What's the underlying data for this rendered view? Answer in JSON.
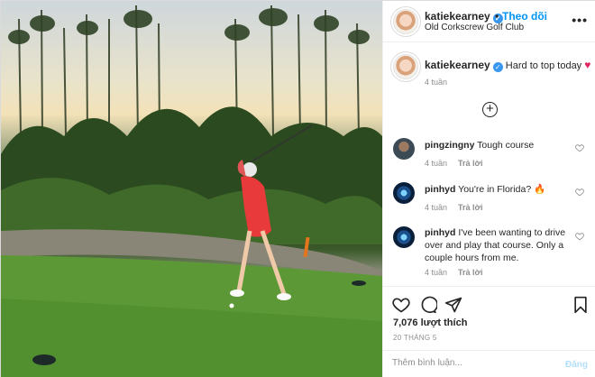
{
  "photo": {
    "description_icon": "golf-swing-photo"
  },
  "header": {
    "username": "katiekearney",
    "follow_label": "Theo dõi",
    "separator": "•",
    "location": "Old Corkscrew Golf Club",
    "more_icon": "more-options-icon",
    "more_text": "•••"
  },
  "caption": {
    "username": "katiekearney",
    "text": "Hard to top today",
    "emoji": "♥",
    "time": "4 tuần"
  },
  "load_more": {
    "icon": "plus-circle-icon",
    "text": "+"
  },
  "comments": [
    {
      "username": "pingzingny",
      "text": "Tough course",
      "time": "4 tuần",
      "reply": "Trả lời"
    },
    {
      "username": "pinhyd",
      "text": "You're in Florida? 🔥",
      "time": "4 tuần",
      "reply": "Trả lời"
    },
    {
      "username": "pinhyd",
      "text": "I've been wanting to drive over and play that course. Only a couple hours from me.",
      "time": "4 tuần",
      "reply": "Trả lời"
    }
  ],
  "actions": {
    "likes": "7,076 lượt thích",
    "date": "20 THÁNG 5"
  },
  "add_comment": {
    "placeholder": "Thêm bình luận...",
    "post_label": "Đăng"
  },
  "colors": {
    "accent": "#0095f6",
    "verified": "#3897f0",
    "heart": "#e0245e",
    "muted": "#8e8e8e"
  }
}
